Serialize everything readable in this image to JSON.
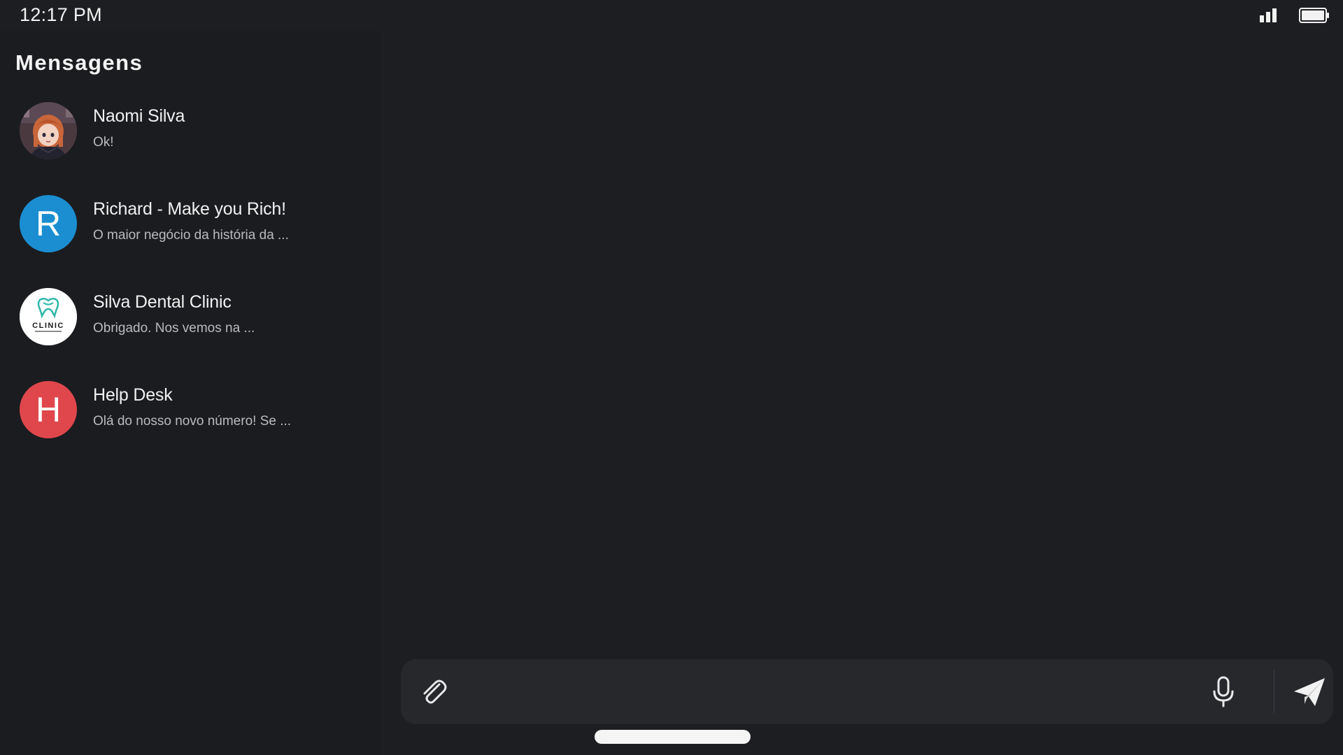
{
  "status_bar": {
    "time": "12:17 PM",
    "signal_icon": "signal-bars-icon",
    "battery_icon": "battery-full-icon"
  },
  "sidebar": {
    "title": "Mensagens",
    "conversations": [
      {
        "name": "Naomi Silva",
        "preview": "Ok!",
        "avatar_type": "photo",
        "avatar_icon": "anime-girl-avatar"
      },
      {
        "name": "Richard - Make you Rich!",
        "preview": "O maior negócio da história da ...",
        "avatar_type": "letter",
        "avatar_letter": "R",
        "avatar_color": "#1b8ed1"
      },
      {
        "name": "Silva Dental Clinic",
        "preview": "Obrigado. Nos vemos na ...",
        "avatar_type": "logo",
        "avatar_logo_text": "CLINIC",
        "avatar_icon": "tooth-logo-icon",
        "avatar_color": "#ffffff"
      },
      {
        "name": "Help Desk",
        "preview": "Olá do nosso novo número! Se ...",
        "avatar_type": "letter",
        "avatar_letter": "H",
        "avatar_color": "#e0474c"
      }
    ]
  },
  "composer": {
    "placeholder": "",
    "value": "",
    "attach_icon": "paperclip-icon",
    "mic_icon": "microphone-icon",
    "send_icon": "paper-plane-icon"
  },
  "colors": {
    "background": "#1d1e22",
    "sidebar": "#1b1c20",
    "composer": "#26282c",
    "text_primary": "#f1f1f1",
    "text_secondary": "#b9bbbe"
  }
}
